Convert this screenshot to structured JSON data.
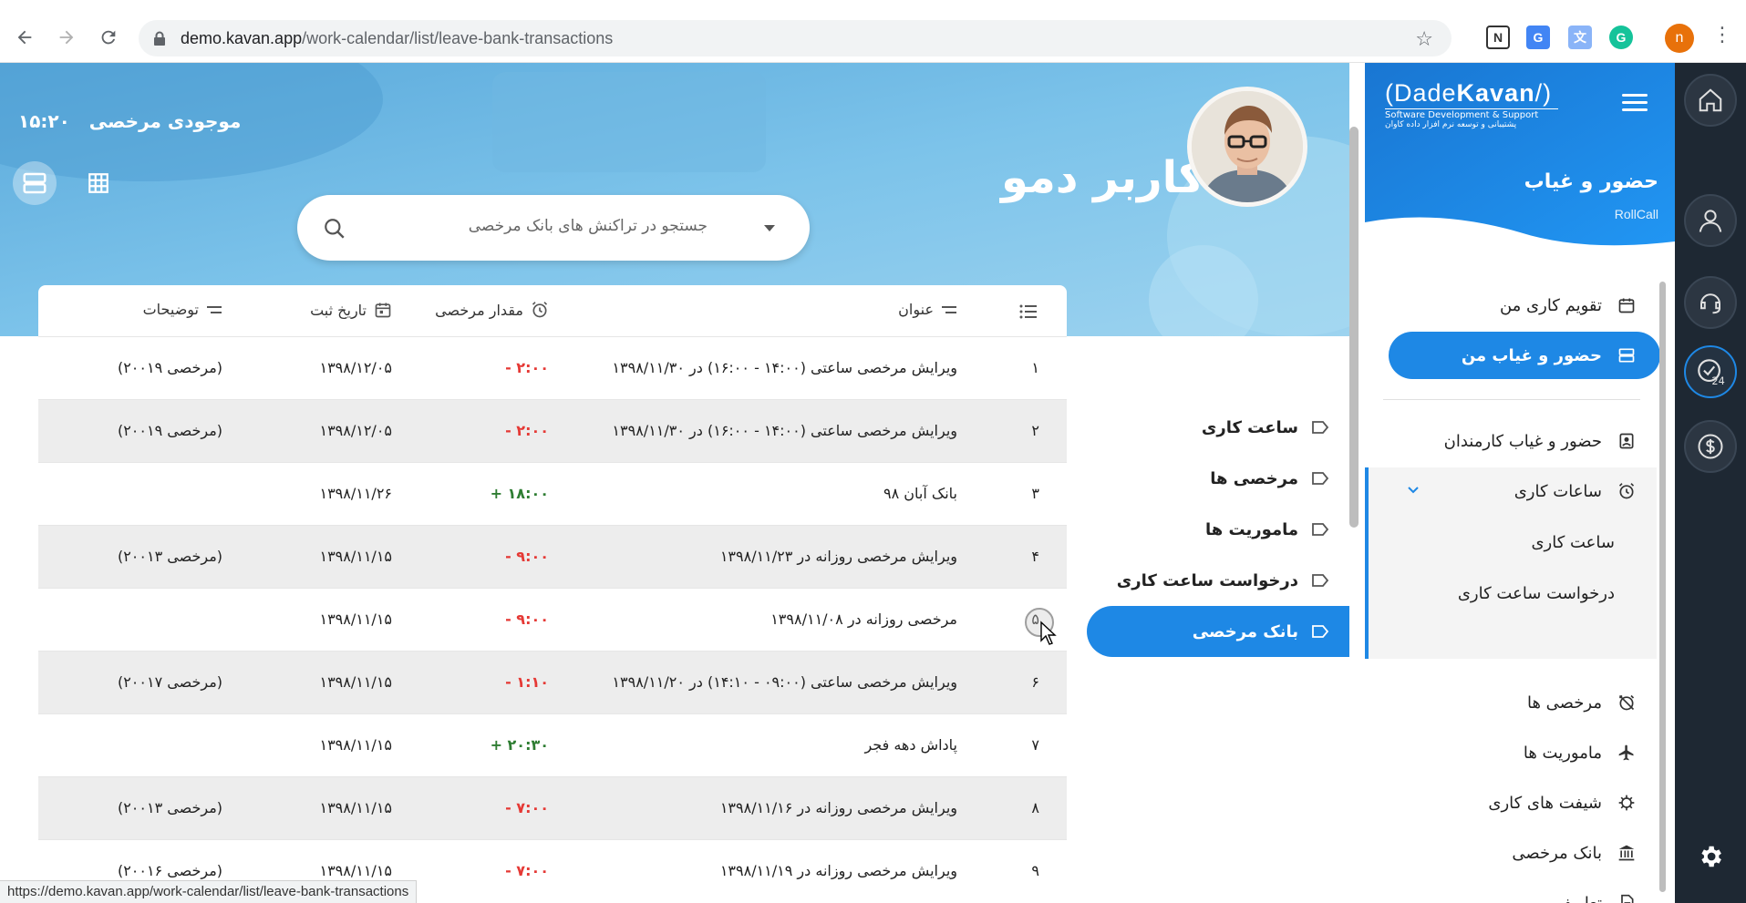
{
  "browser": {
    "url_host": "demo.kavan.app",
    "url_path": "/work-calendar/list/leave-bank-transactions",
    "profile_initial": "n",
    "status_url": "https://demo.kavan.app/work-calendar/list/leave-bank-transactions"
  },
  "brand": {
    "logo_prefix": "(Dade",
    "logo_bold": "Kavan",
    "logo_suffix": "/)",
    "logo_sub_en": "Software Development & Support",
    "logo_sub_fa": "پشتیبانی و توسعه نرم افزار داده کاوان",
    "module_title": "حضور و غیاب",
    "module_subtitle": "RollCall"
  },
  "sidebar": {
    "items": [
      {
        "label": "تقویم کاری من",
        "icon": "calendar-icon"
      },
      {
        "label": "حضور و غیاب من",
        "icon": "rows-icon",
        "active": true
      },
      {
        "label": "حضور و غیاب کارمندان",
        "icon": "badge-icon"
      },
      {
        "label": "ساعات کاری",
        "icon": "alarm-icon",
        "expanded": true
      },
      {
        "label": "ساعت کاری"
      },
      {
        "label": "درخواست ساعت کاری"
      },
      {
        "label": "مرخصی ها",
        "icon": "alarm-off-icon"
      },
      {
        "label": "ماموریت ها",
        "icon": "plane-icon"
      },
      {
        "label": "شیفت های کاری",
        "icon": "shift-icon"
      },
      {
        "label": "بانک مرخصی",
        "icon": "bank-icon"
      },
      {
        "label": "تعاریف",
        "icon": "document-icon"
      }
    ]
  },
  "rail": {
    "icons": [
      "home-icon",
      "user-icon",
      "headset-icon",
      "clock-24-icon",
      "dollar-icon",
      "gear-icon"
    ]
  },
  "header": {
    "balance_label": "موجودی مرخصی",
    "balance_value": "۱۵:۲۰",
    "user_name": "کاربر دمو"
  },
  "search": {
    "placeholder": "جستجو در تراکنش های بانک مرخصی"
  },
  "table": {
    "headers": {
      "title": "عنوان",
      "amount": "مقدار مرخصی",
      "date": "تاریخ ثبت",
      "description": "توضیحات"
    },
    "rows": [
      {
        "idx": "۱",
        "title": "ویرایش مرخصی ساعتی (۱۴:۰۰ - ۱۶:۰۰) در ۱۳۹۸/۱۱/۳۰",
        "amount": "- ۲:۰۰",
        "sign": "neg",
        "date": "۱۳۹۸/۱۲/۰۵",
        "desc": "(مرخصی ۲۰۰۱۹)"
      },
      {
        "idx": "۲",
        "title": "ویرایش مرخصی ساعتی (۱۴:۰۰ - ۱۶:۰۰) در ۱۳۹۸/۱۱/۳۰",
        "amount": "- ۲:۰۰",
        "sign": "neg",
        "date": "۱۳۹۸/۱۲/۰۵",
        "desc": "(مرخصی ۲۰۰۱۹)"
      },
      {
        "idx": "۳",
        "title": "بانک آبان ۹۸",
        "amount": "+ ۱۸:۰۰",
        "sign": "pos",
        "date": "۱۳۹۸/۱۱/۲۶",
        "desc": ""
      },
      {
        "idx": "۴",
        "title": "ویرایش مرخصی روزانه در ۱۳۹۸/۱۱/۲۳",
        "amount": "- ۹:۰۰",
        "sign": "neg",
        "date": "۱۳۹۸/۱۱/۱۵",
        "desc": "(مرخصی ۲۰۰۱۳)"
      },
      {
        "idx": "۵",
        "title": "مرخصی روزانه در ۱۳۹۸/۱۱/۰۸",
        "amount": "- ۹:۰۰",
        "sign": "neg",
        "date": "۱۳۹۸/۱۱/۱۵",
        "desc": ""
      },
      {
        "idx": "۶",
        "title": "ویرایش مرخصی ساعتی (۰۹:۰۰ - ۱۴:۱۰) در ۱۳۹۸/۱۱/۲۰",
        "amount": "- ۱:۱۰",
        "sign": "neg",
        "date": "۱۳۹۸/۱۱/۱۵",
        "desc": "(مرخصی ۲۰۰۱۷)"
      },
      {
        "idx": "۷",
        "title": "پاداش دهه فجر",
        "amount": "+ ۲۰:۳۰",
        "sign": "pos",
        "date": "۱۳۹۸/۱۱/۱۵",
        "desc": ""
      },
      {
        "idx": "۸",
        "title": "ویرایش مرخصی روزانه در ۱۳۹۸/۱۱/۱۶",
        "amount": "- ۷:۰۰",
        "sign": "neg",
        "date": "۱۳۹۸/۱۱/۱۵",
        "desc": "(مرخصی ۲۰۰۱۳)"
      },
      {
        "idx": "۹",
        "title": "ویرایش مرخصی روزانه در ۱۳۹۸/۱۱/۱۹",
        "amount": "- ۷:۰۰",
        "sign": "neg",
        "date": "۱۳۹۸/۱۱/۱۵",
        "desc": "(مرخصی ۲۰۰۱۶)"
      }
    ]
  },
  "submenu": {
    "items": [
      {
        "label": "ساعت کاری"
      },
      {
        "label": "مرخصی ها"
      },
      {
        "label": "ماموریت ها"
      },
      {
        "label": "درخواست ساعت کاری"
      },
      {
        "label": "بانک مرخصی",
        "active": true
      }
    ]
  },
  "colors": {
    "accent": "#1e88e5",
    "negative": "#e53935",
    "positive": "#2e7d32",
    "rail": "#1e2833"
  }
}
